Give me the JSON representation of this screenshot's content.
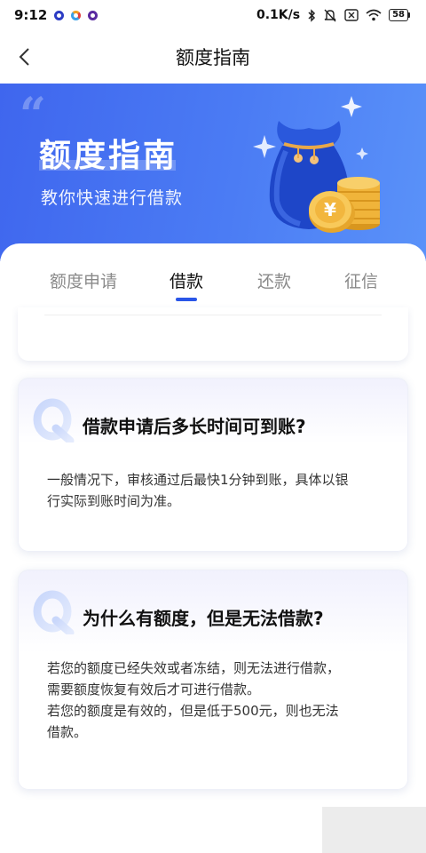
{
  "status_bar": {
    "time": "9:12",
    "network_speed": "0.1K/s",
    "battery": "58",
    "icons": [
      "bluetooth-icon",
      "mute-icon",
      "sim-icon",
      "wifi-icon",
      "battery-icon"
    ]
  },
  "nav": {
    "title": "额度指南",
    "back_icon": "chevron-left-icon"
  },
  "banner": {
    "title": "额度指南",
    "subtitle": "教你快速进行借款",
    "quote_mark": "“",
    "coin_symbol": "¥",
    "colors": {
      "start": "#3f66ee",
      "end": "#5a92f9"
    }
  },
  "tabs": {
    "items": [
      {
        "label": "额度申请",
        "active": false
      },
      {
        "label": "借款",
        "active": true
      },
      {
        "label": "还款",
        "active": false
      },
      {
        "label": "征信",
        "active": false
      }
    ],
    "accent": "#2a56e8"
  },
  "qa": [
    {
      "question": "借款申请后多长时间可到账?",
      "answer": [
        "一般情况下，审核通过后最快1分钟到账，具体以银",
        "行实际到账时间为准。"
      ]
    },
    {
      "question": "为什么有额度，但是无法借款?",
      "answer": [
        "若您的额度已经失效或者冻结，则无法进行借款，",
        "需要额度恢复有效后才可进行借款。",
        "若您的额度是有效的，但是低于500元，则也无法",
        "借款。"
      ]
    }
  ]
}
